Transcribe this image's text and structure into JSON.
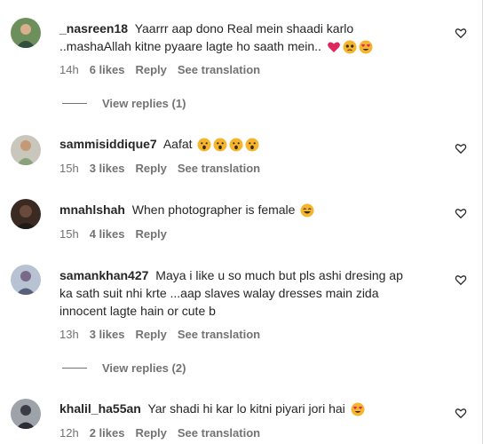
{
  "comments": [
    {
      "username": "_nasreen18",
      "text_line1": "Yaarrr aap dono Real mein shaadi karlo",
      "text_line2": "..mashaAllah kitne pyaare lagte ho saath mein..",
      "emojis": [
        "heart",
        "pleading",
        "heart-eyes"
      ],
      "time": "14h",
      "likes": "6 likes",
      "reply": "Reply",
      "translation": "See translation",
      "view_replies": "View replies (1)"
    },
    {
      "username": "sammisiddique7",
      "text_line1": "Aafat",
      "emojis": [
        "astonished",
        "astonished",
        "astonished",
        "astonished"
      ],
      "time": "15h",
      "likes": "3 likes",
      "reply": "Reply",
      "translation": "See translation"
    },
    {
      "username": "mnahlshah",
      "text_line1": "When photographer is female",
      "emojis": [
        "laughing"
      ],
      "time": "15h",
      "likes": "4 likes",
      "reply": "Reply"
    },
    {
      "username": "samankhan427",
      "text_line1": "Maya i like u so much but pls ashi dresing ap",
      "text_line2": "ka sath suit nhi krte ...aap slaves walay dresses main zida",
      "text_line3": "innocent lagte hain or cute b",
      "time": "13h",
      "likes": "3 likes",
      "reply": "Reply",
      "translation": "See translation",
      "view_replies": "View replies (2)"
    },
    {
      "username": "khalil_ha55an",
      "text_line1": "Yar shadi hi kar lo kitni piyari jori hai",
      "emojis": [
        "heart-eyes"
      ],
      "time": "12h",
      "likes": "2 likes",
      "reply": "Reply",
      "translation": "See translation"
    }
  ],
  "icons": {
    "like": "heart-outline-icon"
  },
  "colors": {
    "text": "#262626",
    "meta": "#737373",
    "emoji": "#f6b52f",
    "heart": "#e0245e"
  }
}
